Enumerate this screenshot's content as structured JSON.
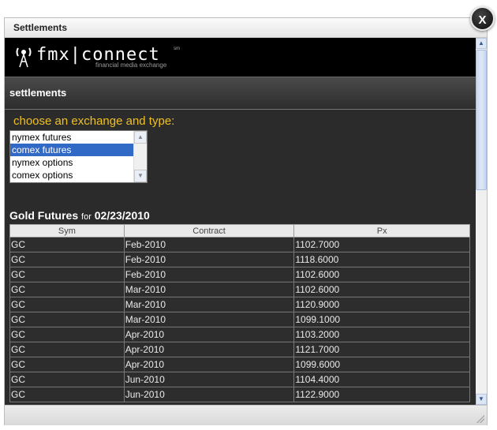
{
  "window": {
    "title": "Settlements",
    "close_label": "X"
  },
  "banner": {
    "logo_text": "fmx|connect",
    "logo_sm": "sm",
    "logo_subtitle": "financial media exchange"
  },
  "section": {
    "title": "settlements"
  },
  "chooser": {
    "prompt": "choose an exchange and type:",
    "options": [
      "nymex futures",
      "comex futures",
      "nymex options",
      "comex options"
    ],
    "selected": "comex futures"
  },
  "table": {
    "title": "Gold Futures",
    "for_label": "for",
    "date": "02/23/2010",
    "columns": [
      "Sym",
      "Contract",
      "Px"
    ],
    "rows": [
      [
        "GC",
        "Feb-2010",
        "1102.7000"
      ],
      [
        "GC",
        "Feb-2010",
        "1118.6000"
      ],
      [
        "GC",
        "Feb-2010",
        "1102.6000"
      ],
      [
        "GC",
        "Mar-2010",
        "1102.6000"
      ],
      [
        "GC",
        "Mar-2010",
        "1120.9000"
      ],
      [
        "GC",
        "Mar-2010",
        "1099.1000"
      ],
      [
        "GC",
        "Apr-2010",
        "1103.2000"
      ],
      [
        "GC",
        "Apr-2010",
        "1121.7000"
      ],
      [
        "GC",
        "Apr-2010",
        "1099.6000"
      ],
      [
        "GC",
        "Jun-2010",
        "1104.4000"
      ],
      [
        "GC",
        "Jun-2010",
        "1122.9000"
      ]
    ]
  },
  "colors": {
    "accent_prompt": "#f0c020",
    "selection": "#3169c6",
    "background": "#2b2b2b"
  }
}
